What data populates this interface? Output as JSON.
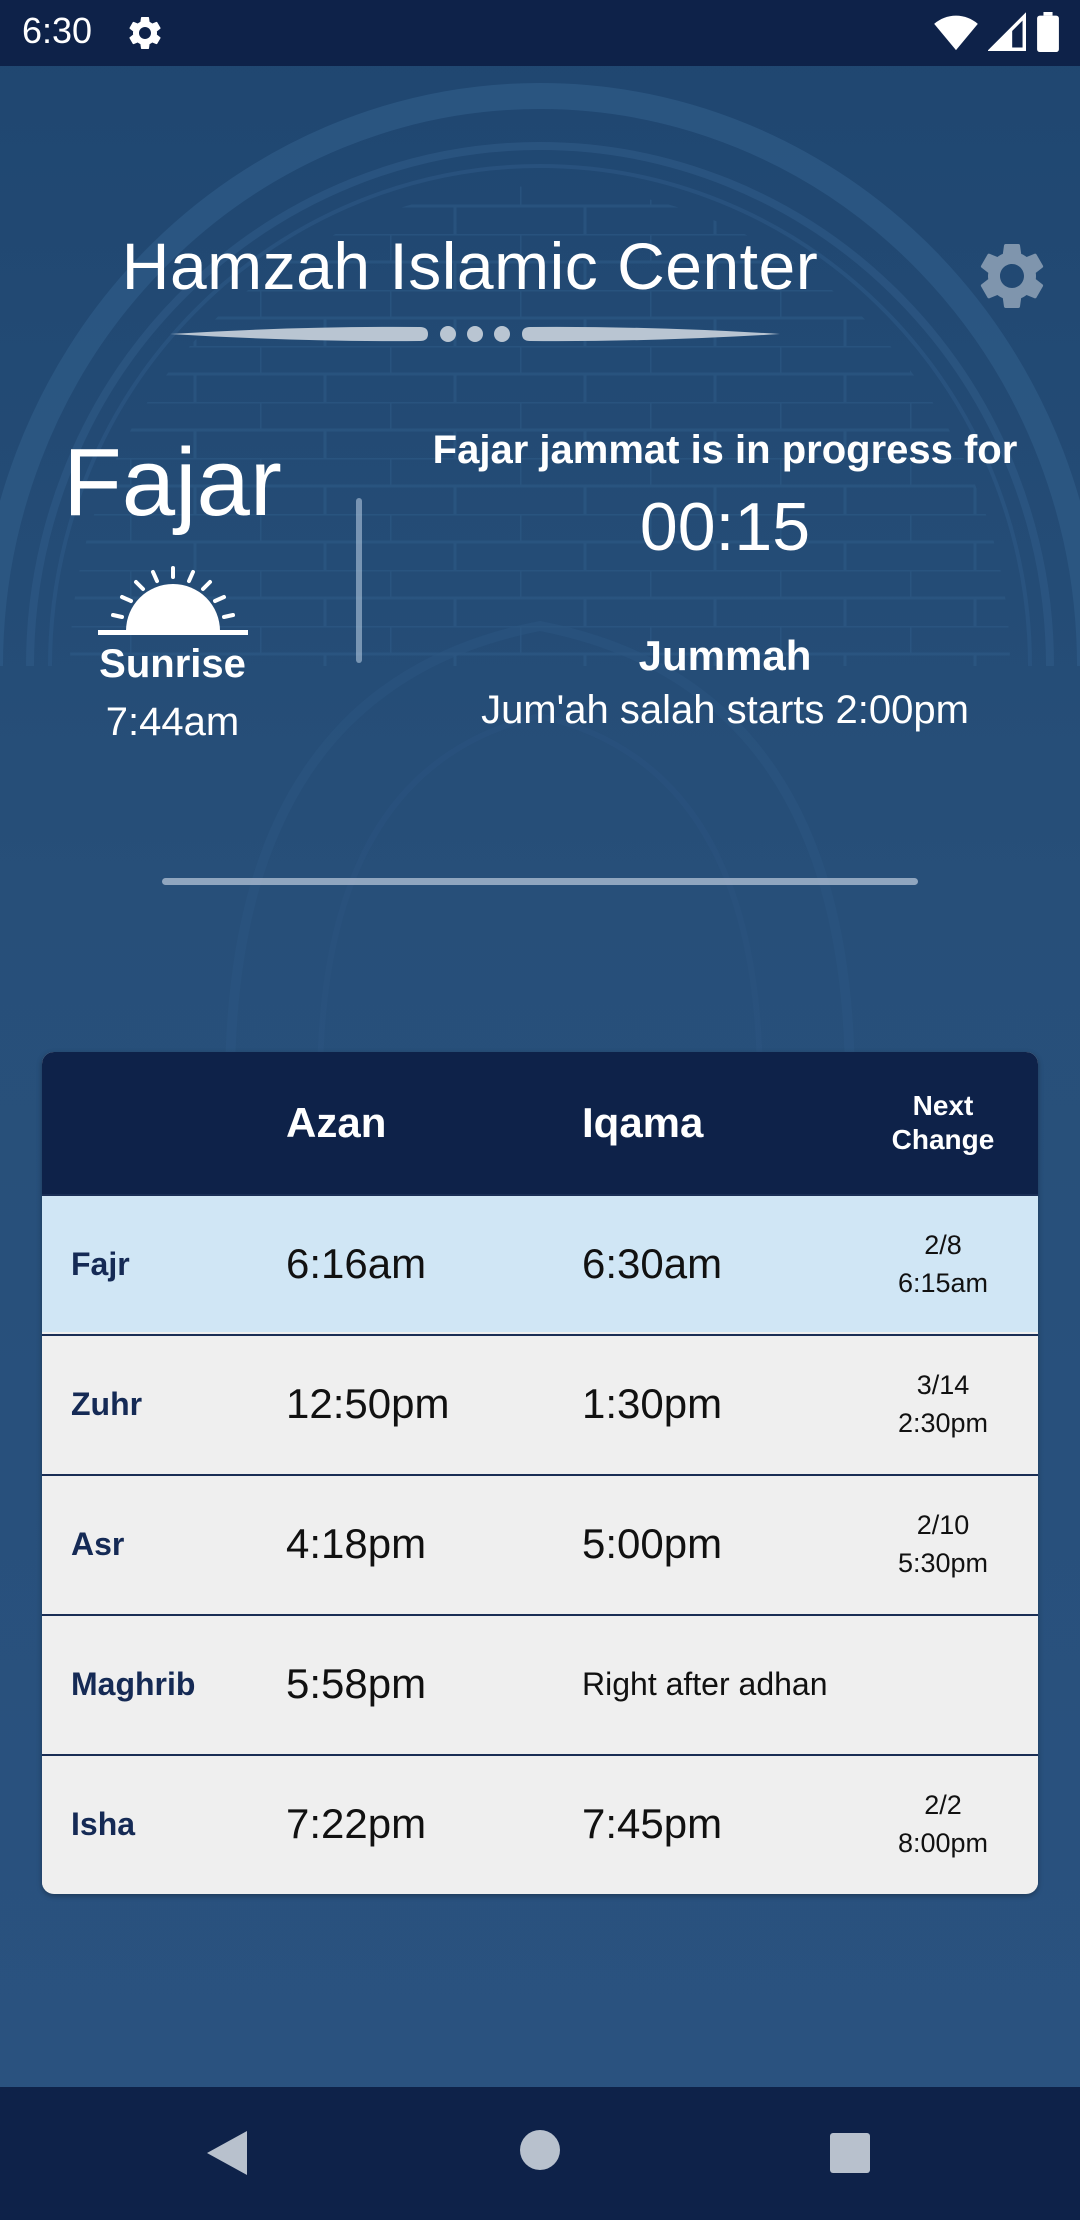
{
  "status_bar": {
    "time": "6:30",
    "icons": [
      "gear-icon",
      "wifi-icon",
      "signal-icon",
      "battery-icon"
    ]
  },
  "header": {
    "mosque_name": "Hamzah Islamic Center",
    "settings_icon": "gear-icon"
  },
  "current": {
    "prayer": "Fajar",
    "sunrise_label": "Sunrise",
    "sunrise_time": "7:44am",
    "jammat_status": "Fajar jammat is in progress for",
    "countdown": "00:15",
    "announcement_title": "Jummah",
    "announcement_text": "Jum'ah salah starts 2:00pm"
  },
  "table": {
    "headers": {
      "azan": "Azan",
      "iqama": "Iqama",
      "next_line1": "Next",
      "next_line2": "Change"
    },
    "rows": [
      {
        "name": "Fajr",
        "azan": "6:16am",
        "iqama": "6:30am",
        "next_date": "2/8",
        "next_time": "6:15am",
        "active": true
      },
      {
        "name": "Zuhr",
        "azan": "12:50pm",
        "iqama": "1:30pm",
        "next_date": "3/14",
        "next_time": "2:30pm",
        "active": false
      },
      {
        "name": "Asr",
        "azan": "4:18pm",
        "iqama": "5:00pm",
        "next_date": "2/10",
        "next_time": "5:30pm",
        "active": false
      },
      {
        "name": "Maghrib",
        "azan": "5:58pm",
        "iqama": "Right after adhan",
        "next_date": "",
        "next_time": "",
        "active": false
      },
      {
        "name": "Isha",
        "azan": "7:22pm",
        "iqama": "7:45pm",
        "next_date": "2/2",
        "next_time": "8:00pm",
        "active": false
      }
    ]
  },
  "colors": {
    "navy": "#0e2249",
    "background": "#274f79",
    "active_row": "#d0e6f5",
    "row": "#efefef"
  },
  "nav_bar": {
    "icons": [
      "back-icon",
      "home-icon",
      "recent-apps-icon"
    ]
  }
}
